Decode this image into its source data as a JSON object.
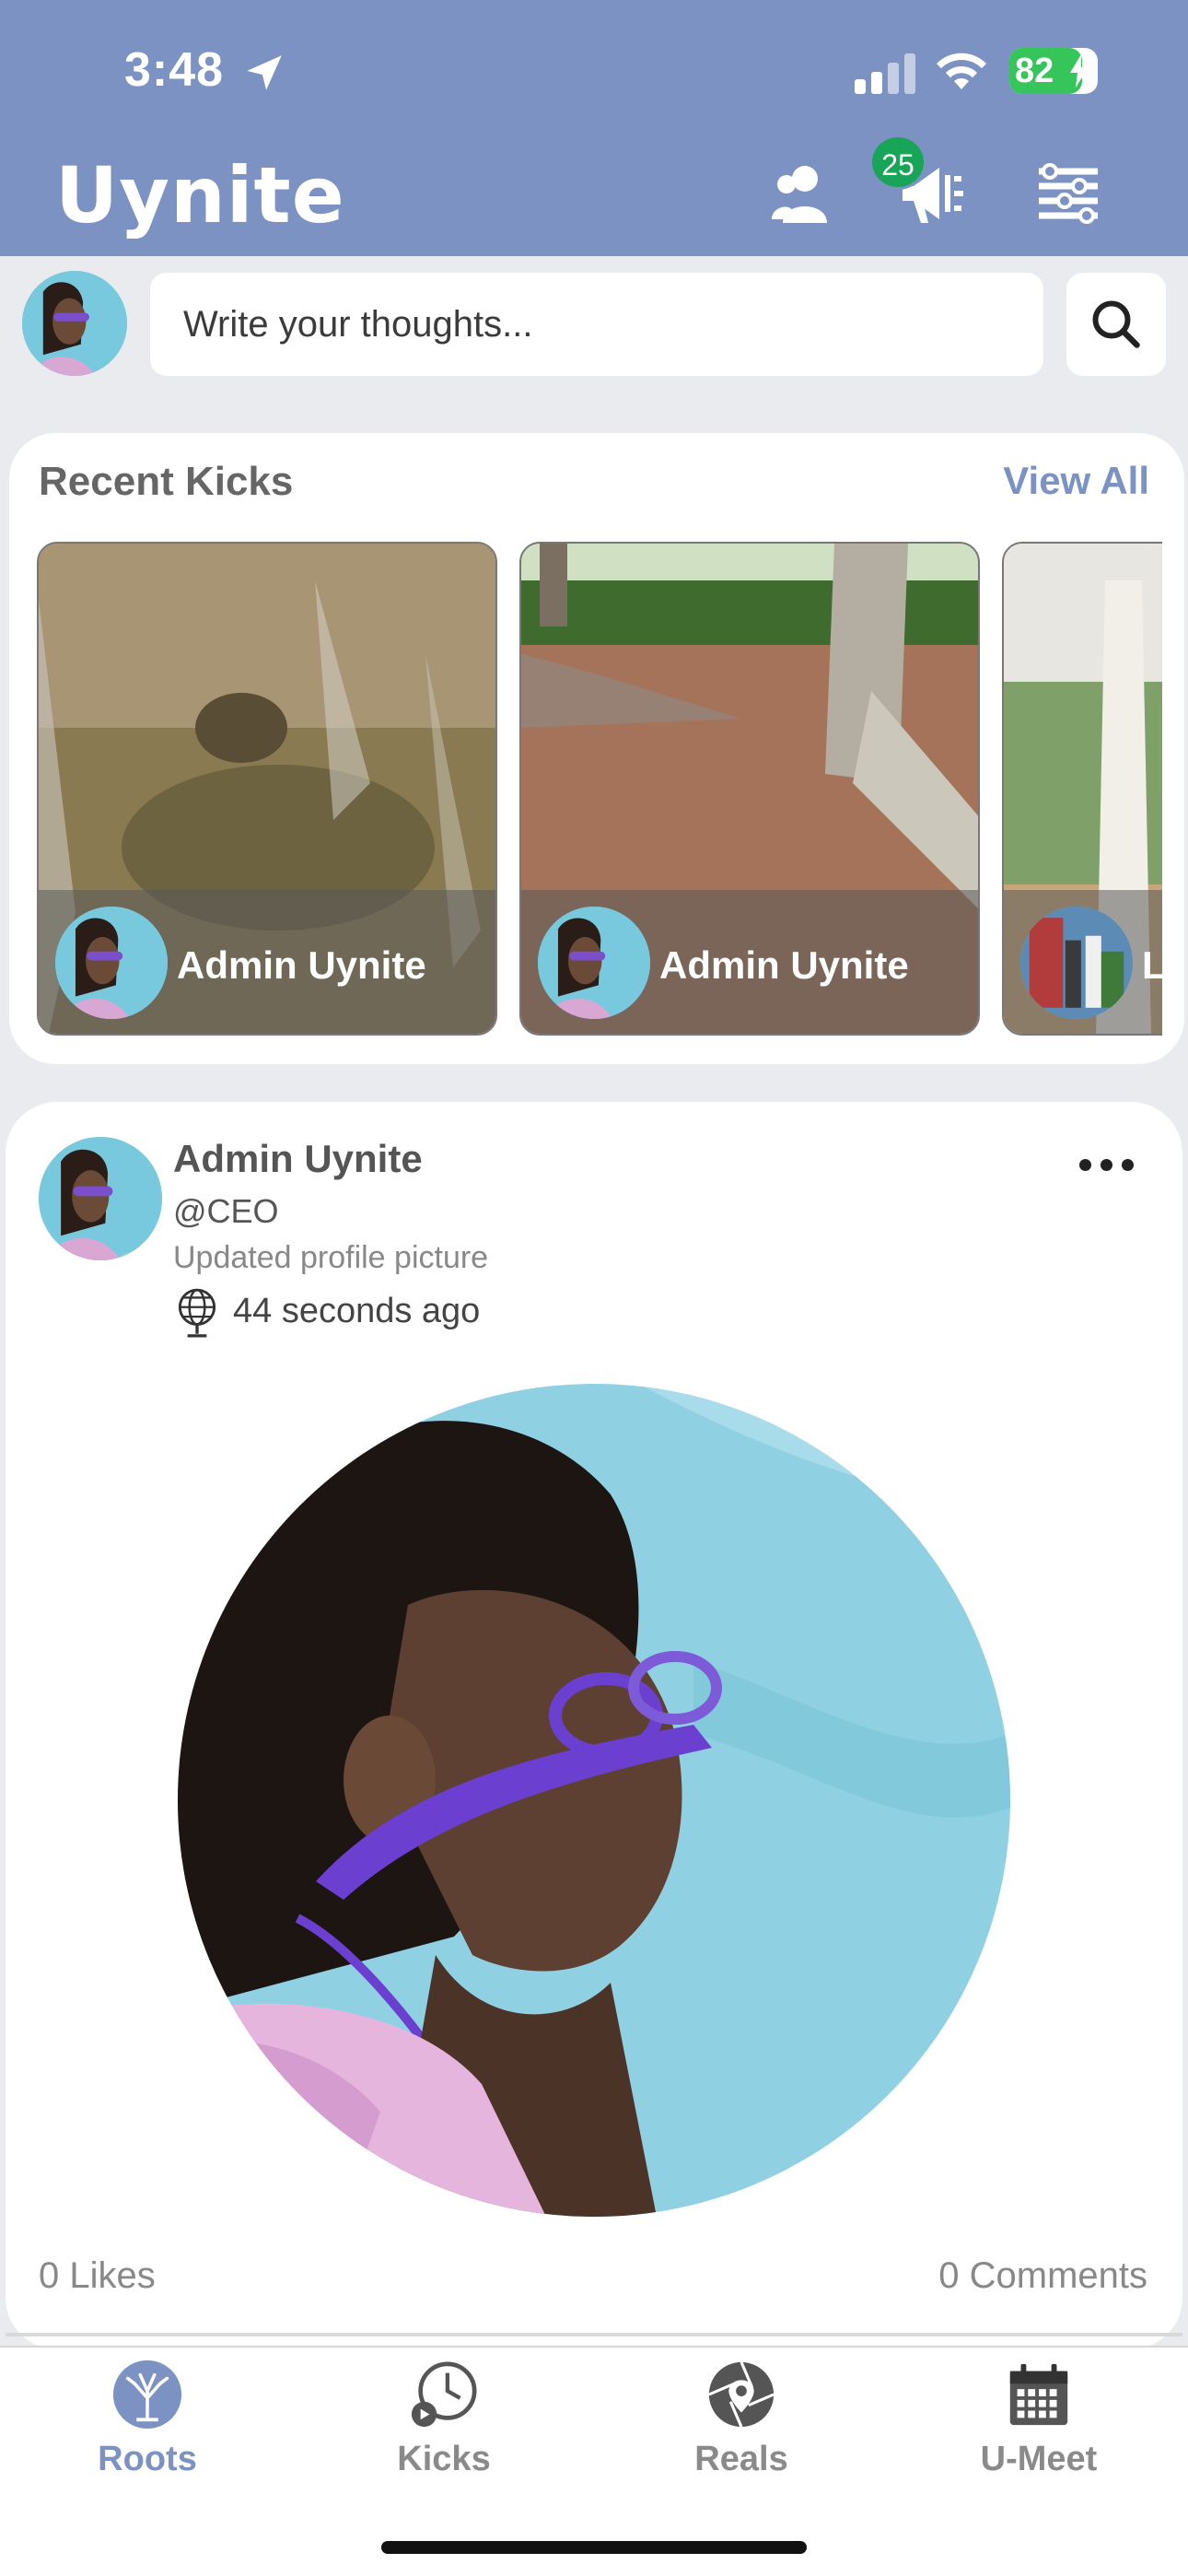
{
  "status_bar": {
    "time": "3:48",
    "battery": "82",
    "battery_level": 0.82
  },
  "header": {
    "logo": "Uynite",
    "notification_count": "25",
    "icons": [
      "contacts-icon",
      "megaphone-icon",
      "settings-sliders-icon"
    ],
    "color": "#7b92c3"
  },
  "composer": {
    "placeholder": "Write your thoughts..."
  },
  "recent_kicks": {
    "title": "Recent Kicks",
    "view_all": "View All",
    "items": [
      {
        "name": "Admin Uynite"
      },
      {
        "name": "Admin Uynite"
      },
      {
        "name": "L"
      }
    ]
  },
  "post": {
    "author": "Admin Uynite",
    "handle": "@CEO",
    "action": "Updated profile picture",
    "time": "44 seconds ago",
    "likes": "0 Likes",
    "comments": "0 Comments"
  },
  "tabs": [
    {
      "label": "Roots",
      "icon": "tree-icon",
      "active": true
    },
    {
      "label": "Kicks",
      "icon": "clock-play-icon",
      "active": false
    },
    {
      "label": "Reals",
      "icon": "aperture-pin-icon",
      "active": false
    },
    {
      "label": "U-Meet",
      "icon": "calendar-icon",
      "active": false
    }
  ],
  "colors": {
    "accent": "#7b92c3",
    "badge": "#18a558",
    "battery": "#34c759"
  }
}
